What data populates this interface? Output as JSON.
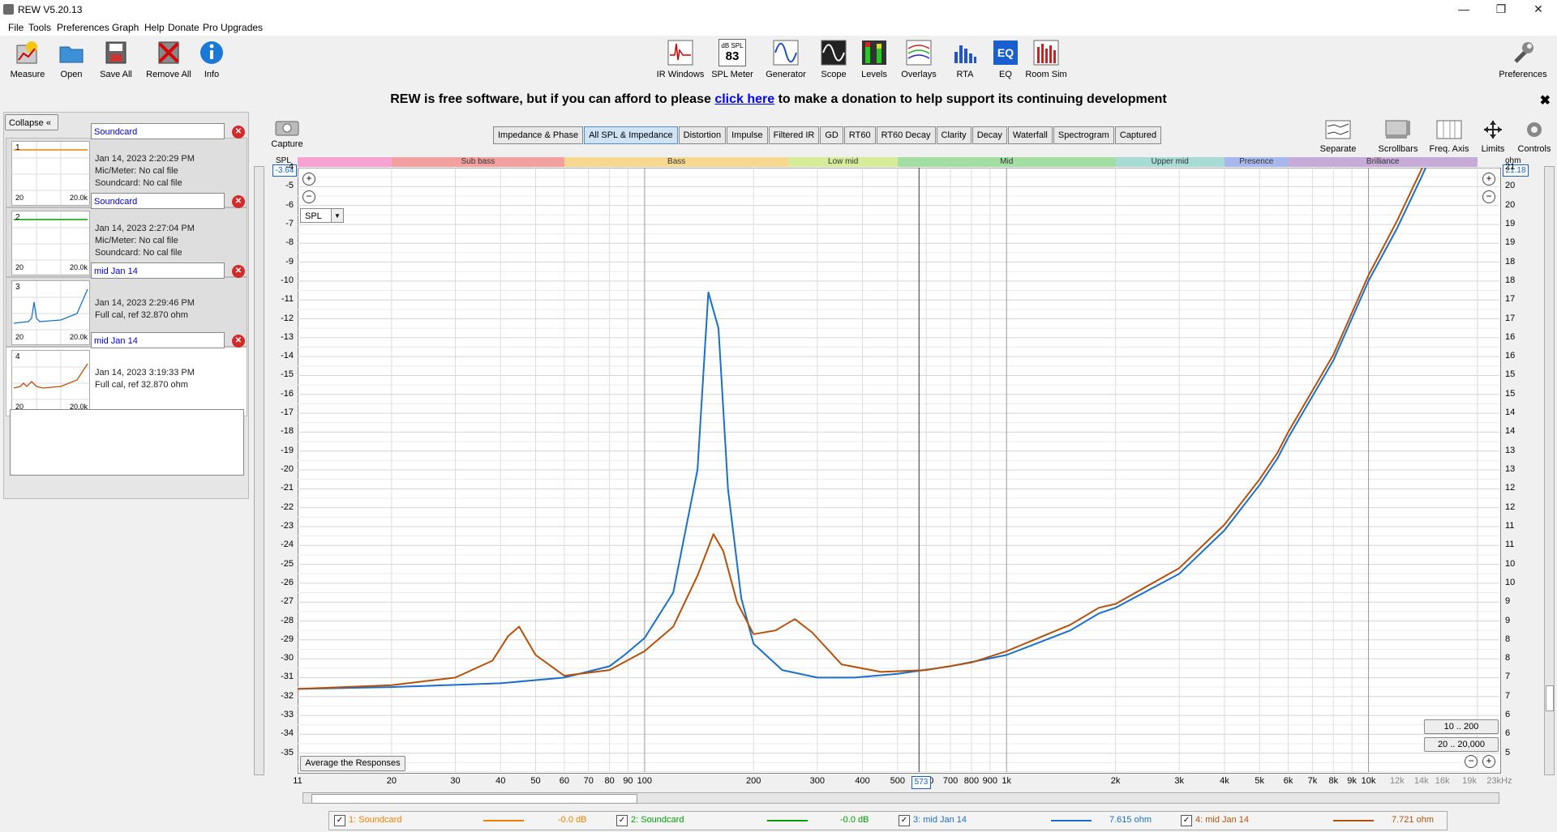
{
  "window": {
    "title": "REW V5.20.13",
    "min_glyph": "—",
    "max_glyph": "❐",
    "close_glyph": "✕"
  },
  "menu": [
    "File",
    "Tools",
    "Preferences",
    "Graph",
    "Help",
    "Donate",
    "Pro Upgrades"
  ],
  "toolbar_left": [
    {
      "label": "Measure",
      "icon": "measure-icon"
    },
    {
      "label": "Open",
      "icon": "folder-icon"
    },
    {
      "label": "Save All",
      "icon": "save-icon"
    },
    {
      "label": "Remove All",
      "icon": "remove-icon"
    },
    {
      "label": "Info",
      "icon": "info-icon"
    }
  ],
  "toolbar_center": [
    {
      "label": "IR Windows",
      "icon": "ir-windows-icon"
    },
    {
      "label": "SPL Meter",
      "icon": "spl-meter-icon",
      "meter_top": "dB SPL",
      "meter_value": "83"
    },
    {
      "label": "Generator",
      "icon": "generator-icon"
    },
    {
      "label": "Scope",
      "icon": "scope-icon"
    },
    {
      "label": "Levels",
      "icon": "levels-icon"
    },
    {
      "label": "Overlays",
      "icon": "overlays-icon"
    },
    {
      "label": "RTA",
      "icon": "rta-icon"
    },
    {
      "label": "EQ",
      "icon": "eq-icon"
    },
    {
      "label": "Room Sim",
      "icon": "room-sim-icon"
    }
  ],
  "toolbar_right": {
    "label": "Preferences",
    "icon": "wrench-icon"
  },
  "donate": {
    "before": "REW is free software, but if you can afford to please ",
    "link": "click here",
    "after": " to make a donation to help support its continuing development",
    "close": "✖"
  },
  "panel": {
    "collapse_label": "Collapse"
  },
  "measurements": [
    {
      "num": "1",
      "name": "Soundcard",
      "date": "Jan 14, 2023 2:20:29 PM",
      "line1": "Mic/Meter: No cal file",
      "line2": "Soundcard: No cal file",
      "color": "#f08000",
      "thumb_max": "20.0k",
      "thumb_min": "20"
    },
    {
      "num": "2",
      "name": "Soundcard",
      "date": "Jan 14, 2023 2:27:04 PM",
      "line1": "Mic/Meter: No cal file",
      "line2": "Soundcard: No cal file",
      "color": "#00a000",
      "thumb_max": "20.0k",
      "thumb_min": "20"
    },
    {
      "num": "3",
      "name": "mid Jan 14",
      "date": "Jan 14, 2023 2:29:46 PM",
      "line1": "Full cal, ref 32.870 ohm",
      "line2": "",
      "color": "#1a6fc8",
      "thumb_max": "20.0k",
      "thumb_min": "20"
    },
    {
      "num": "4",
      "name": "mid Jan 14",
      "date": "Jan 14, 2023 3:19:33 PM",
      "line1": "Full cal, ref 32.870 ohm",
      "line2": "",
      "color": "#b4500a",
      "thumb_max": "20.0k",
      "thumb_min": "20"
    }
  ],
  "tabs": [
    "Impedance & Phase",
    "All SPL & Impedance",
    "Distortion",
    "Impulse",
    "Filtered IR",
    "GD",
    "RT60",
    "RT60 Decay",
    "Clarity",
    "Decay",
    "Waterfall",
    "Spectrogram",
    "Captured"
  ],
  "active_tab": "All SPL & Impedance",
  "capture_label": "Capture",
  "right_tools": [
    {
      "label": "Separate",
      "icon": "separate-icon"
    },
    {
      "label": "Scrollbars",
      "icon": "scrollbars-icon"
    },
    {
      "label": "Freq. Axis",
      "icon": "freq-axis-icon"
    },
    {
      "label": "Limits",
      "icon": "limits-icon"
    },
    {
      "label": "Controls",
      "icon": "controls-icon"
    }
  ],
  "bands": [
    {
      "label": "",
      "color": "#f5a3d3"
    },
    {
      "label": "Sub bass",
      "color": "#f3a0a0"
    },
    {
      "label": "Bass",
      "color": "#f7d890"
    },
    {
      "label": "Low mid",
      "color": "#d6ec9a"
    },
    {
      "label": "Mid",
      "color": "#a3dea3"
    },
    {
      "label": "Upper mid",
      "color": "#a6dbd6"
    },
    {
      "label": "Presence",
      "color": "#a9b8ec"
    },
    {
      "label": "Brilliance",
      "color": "#c6abd9"
    }
  ],
  "graph": {
    "y_left_unit": "SPL",
    "y_right_unit": "ohm",
    "y_left_top_value": "-3.64",
    "y_right_top_value": "21.18",
    "spl_select": "SPL",
    "cursor_freq": "573",
    "avg_button": "Average the Responses",
    "range_buttons": [
      "10 .. 200",
      "20 .. 20,000"
    ]
  },
  "chart_data": {
    "type": "line",
    "x_scale": "log",
    "xlim": [
      11,
      23000
    ],
    "x_ticks": [
      "11",
      "20",
      "30",
      "40",
      "50",
      "60",
      "70",
      "80",
      "90",
      "100",
      "200",
      "300",
      "400",
      "500",
      "600",
      "700",
      "800",
      "900",
      "1k",
      "2k",
      "3k",
      "4k",
      "5k",
      "6k",
      "7k",
      "8k",
      "9k",
      "10k",
      "12k",
      "14k",
      "16k",
      "19k",
      "23kHz"
    ],
    "ylim_left": [
      -36,
      -4
    ],
    "ylim_right": [
      5,
      21
    ],
    "y_left_ticks": [
      "-4",
      "-5",
      "-6",
      "-7",
      "-8",
      "-9",
      "-10",
      "-11",
      "-12",
      "-13",
      "-14",
      "-15",
      "-16",
      "-17",
      "-18",
      "-19",
      "-20",
      "-21",
      "-22",
      "-23",
      "-24",
      "-25",
      "-26",
      "-27",
      "-28",
      "-29",
      "-30",
      "-31",
      "-32",
      "-33",
      "-34",
      "-35"
    ],
    "y_right_ticks": [
      "21",
      "20",
      "20",
      "19",
      "19",
      "18",
      "18",
      "17",
      "17",
      "16",
      "16",
      "15",
      "15",
      "14",
      "14",
      "13",
      "13",
      "12",
      "12",
      "11",
      "11",
      "10",
      "10",
      "9",
      "9",
      "8",
      "8",
      "7",
      "7",
      "6",
      "6",
      "5"
    ],
    "grid": true,
    "series": [
      {
        "name": "3: mid Jan 14",
        "color": "#1a6fc8",
        "x": [
          11,
          20,
          40,
          60,
          80,
          88,
          100,
          120,
          140,
          150,
          160,
          170,
          185,
          200,
          240,
          300,
          380,
          500,
          700,
          1000,
          1500,
          1800,
          2000,
          3000,
          4000,
          5000,
          5600,
          6000,
          8000,
          10000,
          12000,
          14000,
          16000,
          18000
        ],
        "y": [
          -31.6,
          -31.5,
          -31.3,
          -31.0,
          -30.4,
          -29.8,
          -28.9,
          -26.5,
          -20.0,
          -10.6,
          -12.5,
          -21.0,
          -26.8,
          -29.2,
          -30.6,
          -31.0,
          -31.0,
          -30.8,
          -30.4,
          -29.8,
          -28.5,
          -27.6,
          -27.3,
          -25.5,
          -23.2,
          -20.8,
          -19.4,
          -18.3,
          -14.2,
          -10.0,
          -7.2,
          -4.5,
          -2.0,
          0.5
        ]
      },
      {
        "name": "4: mid Jan 14",
        "color": "#b4500a",
        "x": [
          11,
          20,
          30,
          38,
          42,
          45,
          50,
          60,
          80,
          100,
          120,
          140,
          155,
          165,
          180,
          200,
          230,
          260,
          290,
          350,
          450,
          600,
          800,
          1000,
          1500,
          1800,
          2000,
          3000,
          4000,
          5000,
          5600,
          6000,
          8000,
          10000,
          12000,
          14000,
          16000
        ],
        "y": [
          -31.6,
          -31.4,
          -31.0,
          -30.1,
          -28.8,
          -28.3,
          -29.8,
          -30.9,
          -30.6,
          -29.6,
          -28.3,
          -25.6,
          -23.4,
          -24.3,
          -27.0,
          -28.7,
          -28.5,
          -27.9,
          -28.6,
          -30.3,
          -30.7,
          -30.6,
          -30.2,
          -29.6,
          -28.2,
          -27.3,
          -27.1,
          -25.2,
          -22.9,
          -20.5,
          -19.1,
          -18.0,
          -13.9,
          -9.7,
          -6.8,
          -4.1,
          -1.6
        ]
      }
    ]
  },
  "legend": [
    {
      "label": "1: Soundcard",
      "color": "#f08000",
      "value": "-0.0 dB",
      "checked": "✓"
    },
    {
      "label": "2: Soundcard",
      "color": "#00a000",
      "value": "-0.0 dB",
      "checked": "✓"
    },
    {
      "label": "3: mid Jan 14",
      "color": "#1a6fc8",
      "value": "7.615 ohm",
      "checked": "✓"
    },
    {
      "label": "4: mid Jan 14",
      "color": "#b4500a",
      "value": "7.721 ohm",
      "checked": "✓"
    }
  ]
}
